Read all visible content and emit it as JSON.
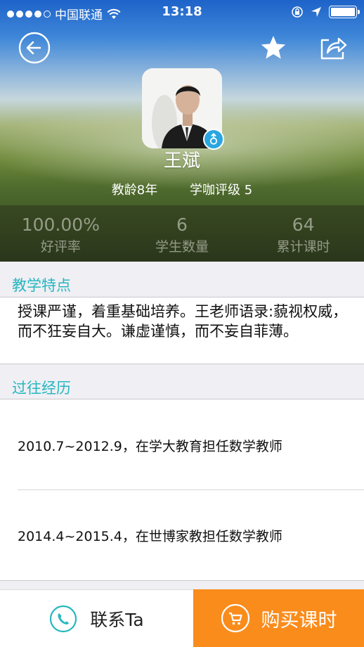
{
  "status_bar": {
    "carrier": "中国联通",
    "time": "13:18",
    "battery_level": 1.0
  },
  "icons": {
    "back": "back-arrow-icon",
    "favorite": "star-icon",
    "share": "share-icon",
    "gender": "male-icon",
    "contact": "phone-icon",
    "buy": "cart-icon"
  },
  "teacher": {
    "name": "王斌",
    "teaching_years": "教龄8年",
    "rating": "学咖评级 5"
  },
  "stats": [
    {
      "value": "100.00%",
      "label": "好评率"
    },
    {
      "value": "6",
      "label": "学生数量"
    },
    {
      "value": "64",
      "label": "累计课时"
    }
  ],
  "features": {
    "title": "教学特点",
    "text": "授课严谨，着重基础培养。王老师语录:藐视权威，而不狂妄自大。谦虚谨慎，而不妄自菲薄。"
  },
  "history": {
    "title": "过往经历",
    "items": [
      "2010.7~2012.9，在学大教育担任数学教师",
      "2014.4~2015.4，在世博家教担任数学教师"
    ]
  },
  "actions": {
    "contact_label": "联系Ta",
    "buy_label": "购买课时"
  },
  "colors": {
    "accent": "#26b7c0",
    "buy": "#fa8c1c",
    "badge": "#2aa6e0"
  }
}
